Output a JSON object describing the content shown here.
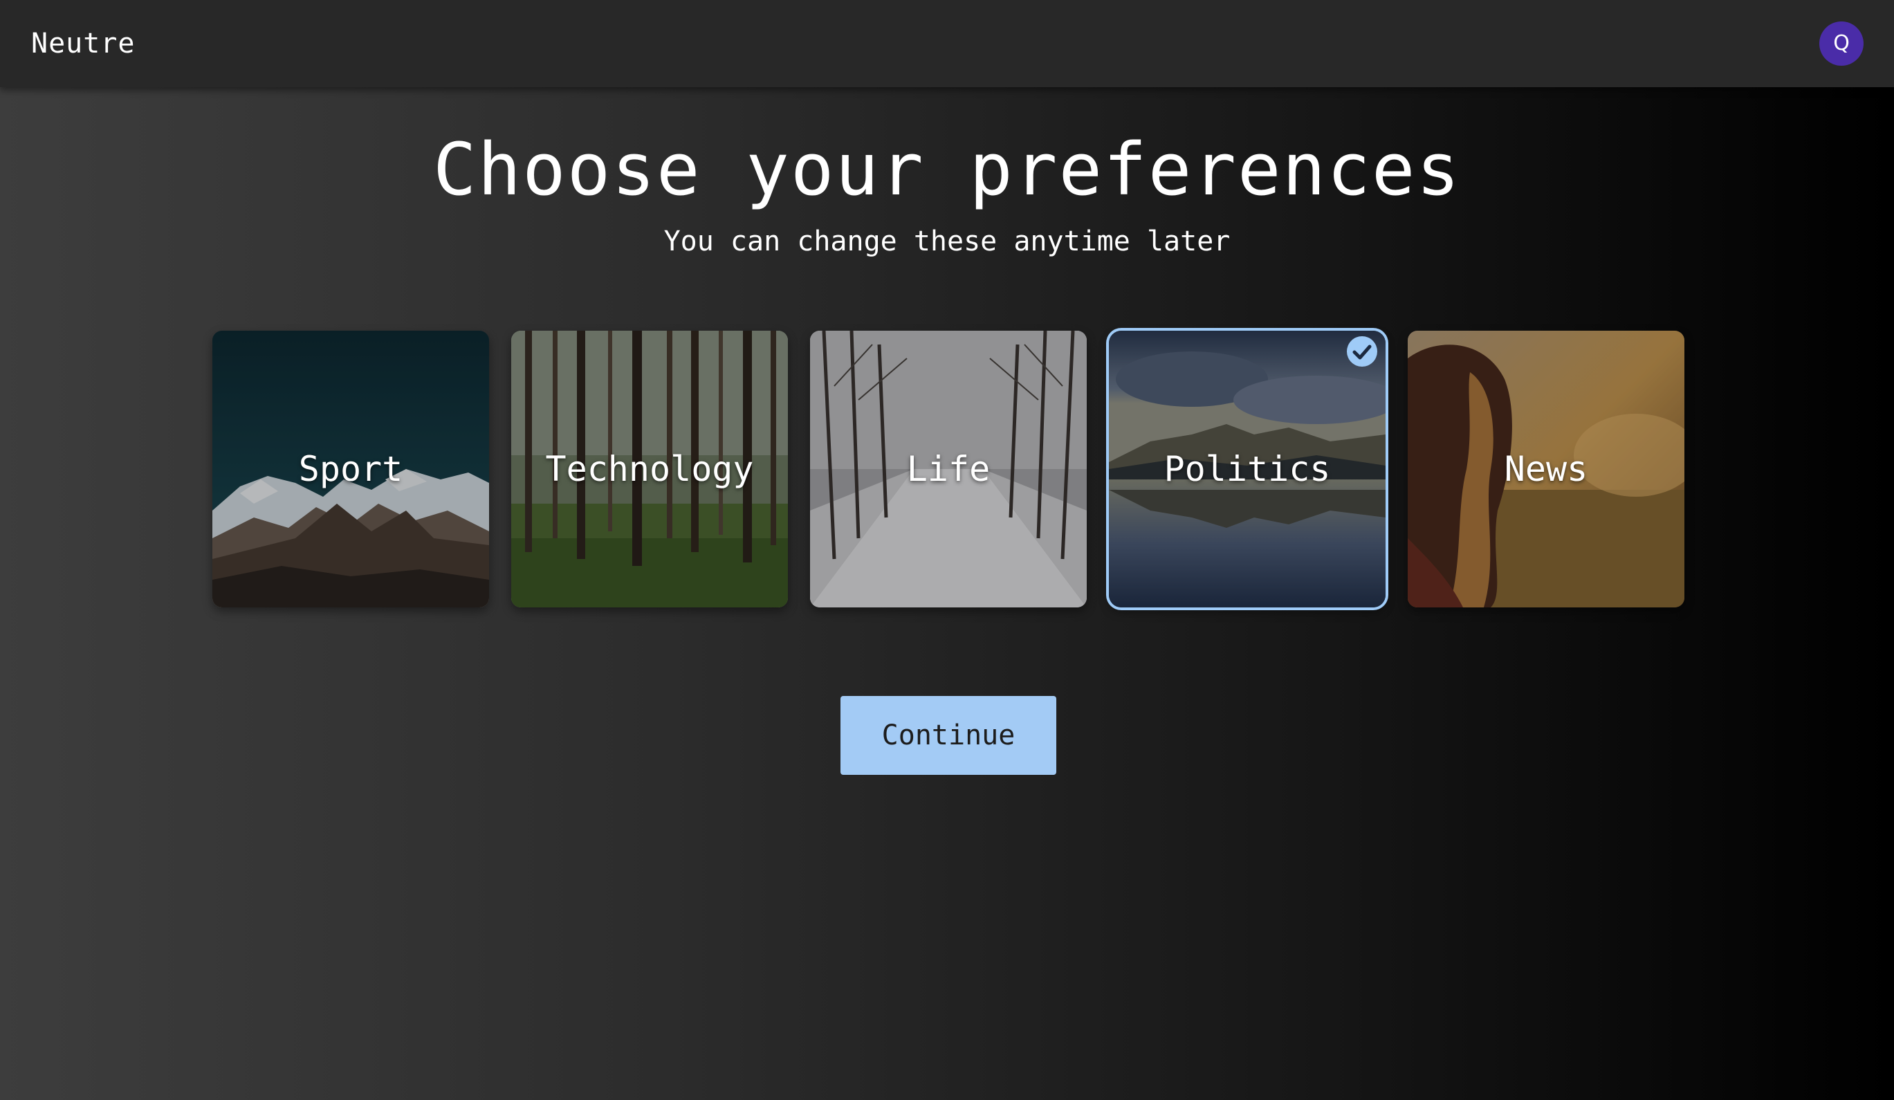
{
  "app": {
    "brand": "Neutre",
    "avatar_initial": "Q",
    "avatar_color": "#4a2ca8"
  },
  "header": {
    "title": "Choose your preferences",
    "subtitle": "You can change these anytime later"
  },
  "categories": [
    {
      "label": "Sport",
      "selected": false,
      "image": "snowy-mountain-night"
    },
    {
      "label": "Technology",
      "selected": false,
      "image": "pine-forest"
    },
    {
      "label": "Life",
      "selected": false,
      "image": "snowy-tree-path"
    },
    {
      "label": "Politics",
      "selected": true,
      "image": "mountain-lake-reflection"
    },
    {
      "label": "News",
      "selected": false,
      "image": "woman-in-golden-field"
    }
  ],
  "actions": {
    "continue_label": "Continue"
  },
  "colors": {
    "accent": "#a3cbf5",
    "selected_border": "#9fcbf7",
    "topbar": "#282828"
  },
  "icons": {
    "selected_check": "check-circle-icon"
  }
}
